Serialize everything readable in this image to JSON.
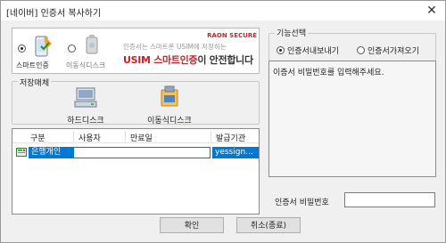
{
  "window": {
    "title": "[네이버] 인증서 복사하기"
  },
  "location": {
    "options": [
      {
        "label": "스마트인증",
        "selected": true,
        "icon": "smartphone-cert-icon"
      },
      {
        "label": "이동식디스크",
        "selected": false,
        "icon": "usb-disk-icon"
      }
    ],
    "ad": {
      "brand": "RAON SECURE",
      "line1": "인증서는 스마트폰 USIM에 저장하는",
      "line2_red": "USIM 스마트인증",
      "line2_dark": "이 안전합니다"
    }
  },
  "storage": {
    "label": "저장매체",
    "items": [
      {
        "label": "하드디스크",
        "icon": "hard-disk-icon"
      },
      {
        "label": "이동식디스크",
        "icon": "removable-disk-icon"
      }
    ]
  },
  "table": {
    "columns": [
      "구분",
      "사용자",
      "만료일",
      "발급기관"
    ],
    "rows": [
      {
        "type": "은행개인",
        "user": "",
        "expiry": "",
        "issuer": "yessign..."
      }
    ]
  },
  "function": {
    "label": "기능선택",
    "options": [
      {
        "label": "인증서내보내기",
        "selected": true
      },
      {
        "label": "인증서가져오기",
        "selected": false
      }
    ]
  },
  "message": "이증서 비밀번호를 입력해주세요.",
  "password": {
    "label": "인증서 비밀번호",
    "value": ""
  },
  "buttons": {
    "ok": "확인",
    "cancel": "취소(종료)"
  },
  "colors": {
    "selection": "#0078d7",
    "ad_red": "#d0202a"
  }
}
